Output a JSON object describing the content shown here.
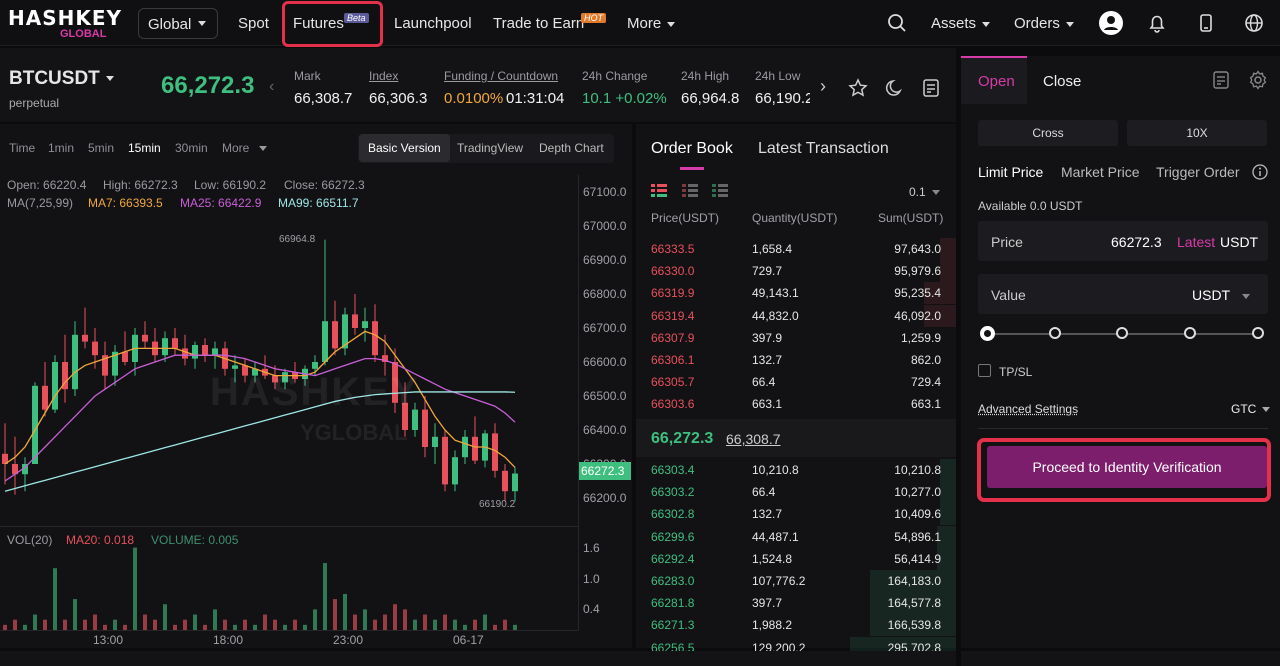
{
  "brand": {
    "logo": "HASHKEY",
    "logo_sub": "GLOBAL"
  },
  "nav": {
    "region": "Global",
    "links": [
      "Spot",
      "Futures",
      "Launchpool",
      "Trade to Earn",
      "More"
    ],
    "futures_badge": "Beta",
    "earn_badge": "HOT",
    "assets": "Assets",
    "orders": "Orders"
  },
  "ticker": {
    "pair": "BTCUSDT",
    "type": "perpetual",
    "last": "66,272.3",
    "stats": [
      {
        "label": "Mark",
        "value": "66,308.7"
      },
      {
        "label": "Index",
        "value": "66,306.3"
      },
      {
        "label": "Funding / Countdown",
        "value": "0.0100%",
        "value2": "01:31:04"
      },
      {
        "label": "24h Change",
        "value": "10.1 +0.02%"
      },
      {
        "label": "24h High",
        "value": "66,964.8"
      },
      {
        "label": "24h Low",
        "value": "66,190.2"
      }
    ]
  },
  "chart": {
    "timeframes": [
      "Time",
      "1min",
      "5min",
      "15min",
      "30min",
      "More"
    ],
    "versions": [
      "Basic Version",
      "TradingView",
      "Depth Chart"
    ],
    "ohlc": {
      "open": "Open: 66220.4",
      "high": "High: 66272.3",
      "low": "Low: 66190.2",
      "close": "Close: 66272.3"
    },
    "ma": {
      "label": "MA(7,25,99)",
      "ma7": "MA7: 66393.5",
      "ma25": "MA25: 66422.9",
      "ma99": "MA99: 66511.7"
    },
    "vol": {
      "label": "VOL(20)",
      "ma20": "MA20: 0.018",
      "volume": "VOLUME: 0.005"
    },
    "marker_high": "66964.8",
    "marker_low": "66190.2",
    "current_tag": "66272.3",
    "watermark": "HASHKEY",
    "watermark_sub": "YGLOBAL",
    "colors": {
      "up": "#3fbf7f",
      "down": "#e8505b",
      "ma7": "#f0a83a",
      "ma25": "#c95fd8",
      "ma99": "#9fe6e6"
    }
  },
  "chart_data": {
    "type": "line",
    "y_ticks": [
      "67100.0",
      "67000.0",
      "66900.0",
      "66800.0",
      "66700.0",
      "66600.0",
      "66500.0",
      "66400.0",
      "66300.0",
      "66200.0"
    ],
    "x_ticks": [
      "13:00",
      "18:00",
      "23:00",
      "06-17"
    ],
    "vol_ticks": [
      "1.6",
      "1.0",
      "0.4"
    ],
    "candles": [
      [
        66330,
        66420,
        66240,
        66300
      ],
      [
        66300,
        66380,
        66210,
        66270
      ],
      [
        66270,
        66320,
        66220,
        66300
      ],
      [
        66300,
        66540,
        66300,
        66530
      ],
      [
        66530,
        66600,
        66440,
        66460
      ],
      [
        66460,
        66620,
        66450,
        66600
      ],
      [
        66600,
        66680,
        66480,
        66520
      ],
      [
        66520,
        66720,
        66500,
        66680
      ],
      [
        66680,
        66760,
        66640,
        66660
      ],
      [
        66660,
        66700,
        66580,
        66620
      ],
      [
        66620,
        66660,
        66520,
        66560
      ],
      [
        66560,
        66650,
        66530,
        66630
      ],
      [
        66630,
        66690,
        66590,
        66600
      ],
      [
        66600,
        66700,
        66560,
        66680
      ],
      [
        66680,
        66720,
        66640,
        66660
      ],
      [
        66660,
        66700,
        66600,
        66620
      ],
      [
        66620,
        66690,
        66600,
        66670
      ],
      [
        66670,
        66700,
        66620,
        66640
      ],
      [
        66640,
        66680,
        66590,
        66610
      ],
      [
        66610,
        66660,
        66580,
        66650
      ],
      [
        66650,
        66670,
        66600,
        66620
      ],
      [
        66620,
        66660,
        66580,
        66640
      ],
      [
        66640,
        66660,
        66560,
        66580
      ],
      [
        66580,
        66620,
        66540,
        66590
      ],
      [
        66590,
        66610,
        66540,
        66560
      ],
      [
        66560,
        66600,
        66540,
        66580
      ],
      [
        66580,
        66620,
        66550,
        66560
      ],
      [
        66560,
        66590,
        66520,
        66540
      ],
      [
        66540,
        66580,
        66520,
        66570
      ],
      [
        66570,
        66600,
        66540,
        66550
      ],
      [
        66550,
        66590,
        66530,
        66580
      ],
      [
        66580,
        66620,
        66560,
        66600
      ],
      [
        66600,
        66960,
        66590,
        66720
      ],
      [
        66720,
        66780,
        66620,
        66640
      ],
      [
        66640,
        66760,
        66620,
        66740
      ],
      [
        66740,
        66800,
        66680,
        66700
      ],
      [
        66700,
        66760,
        66660,
        66720
      ],
      [
        66720,
        66770,
        66600,
        66620
      ],
      [
        66620,
        66680,
        66560,
        66600
      ],
      [
        66600,
        66640,
        66450,
        66480
      ],
      [
        66480,
        66540,
        66380,
        66400
      ],
      [
        66400,
        66480,
        66380,
        66460
      ],
      [
        66460,
        66500,
        66320,
        66350
      ],
      [
        66350,
        66420,
        66300,
        66380
      ],
      [
        66380,
        66400,
        66220,
        66240
      ],
      [
        66240,
        66340,
        66220,
        66320
      ],
      [
        66320,
        66400,
        66300,
        66380
      ],
      [
        66380,
        66440,
        66300,
        66310
      ],
      [
        66310,
        66400,
        66290,
        66390
      ],
      [
        66390,
        66420,
        66260,
        66280
      ],
      [
        66280,
        66300,
        66190,
        66220
      ],
      [
        66220,
        66290,
        66190,
        66272
      ]
    ],
    "ma7": [
      66300,
      66320,
      66350,
      66400,
      66450,
      66500,
      66540,
      66570,
      66590,
      66600,
      66610,
      66620,
      66630,
      66640,
      66640,
      66640,
      66640,
      66640,
      66630,
      66620,
      66620,
      66620,
      66610,
      66600,
      66590,
      66580,
      66570,
      66560,
      66560,
      66560,
      66560,
      66570,
      66600,
      66630,
      66650,
      66670,
      66690,
      66680,
      66660,
      66620,
      66580,
      66540,
      66490,
      66440,
      66400,
      66370,
      66360,
      66350,
      66350,
      66340,
      66320,
      66290
    ],
    "ma25": [
      66250,
      66270,
      66290,
      66320,
      66350,
      66380,
      66410,
      66440,
      66470,
      66500,
      66520,
      66540,
      66560,
      66580,
      66590,
      66600,
      66610,
      66620,
      66620,
      66620,
      66620,
      66620,
      66620,
      66615,
      66610,
      66600,
      66590,
      66580,
      66575,
      66570,
      66565,
      66560,
      66570,
      66580,
      66590,
      66600,
      66610,
      66610,
      66605,
      66595,
      66580,
      66565,
      66550,
      66535,
      66520,
      66510,
      66500,
      66490,
      66480,
      66470,
      66450,
      66423
    ],
    "ma99": [
      66220,
      66228,
      66236,
      66244,
      66252,
      66260,
      66268,
      66276,
      66284,
      66292,
      66300,
      66308,
      66316,
      66324,
      66332,
      66340,
      66348,
      66356,
      66364,
      66372,
      66380,
      66388,
      66396,
      66404,
      66412,
      66420,
      66428,
      66436,
      66444,
      66452,
      66460,
      66468,
      66476,
      66484,
      66490,
      66496,
      66500,
      66504,
      66506,
      66508,
      66510,
      66512,
      66512,
      66512,
      66512,
      66512,
      66512,
      66512,
      66512,
      66512,
      66512,
      66511
    ],
    "volume": [
      0.1,
      0.2,
      0.1,
      0.3,
      0.2,
      1.2,
      0.2,
      0.6,
      0.2,
      0.3,
      0.1,
      0.2,
      0.1,
      1.6,
      0.3,
      0.2,
      0.5,
      0.1,
      0.2,
      0.3,
      0.1,
      0.4,
      0.2,
      0.1,
      0.2,
      0.1,
      0.3,
      0.2,
      0.1,
      0.2,
      0.1,
      0.4,
      1.3,
      0.6,
      0.7,
      0.3,
      0.4,
      0.2,
      0.3,
      0.5,
      0.4,
      0.2,
      0.3,
      0.2,
      0.3,
      0.2,
      0.1,
      0.2,
      0.3,
      0.1,
      0.2,
      0.1
    ],
    "ylim": [
      66150,
      67150
    ]
  },
  "book": {
    "tabs": [
      "Order Book",
      "Latest Transaction"
    ],
    "precision": "0.1",
    "headers": [
      "Price(USDT)",
      "Quantity(USDT)",
      "Sum(USDT)"
    ],
    "asks": [
      [
        "66333.5",
        "1,658.4",
        "97,643.0",
        0.05
      ],
      [
        "66330.0",
        "729.7",
        "95,979.6",
        0.05
      ],
      [
        "66319.9",
        "49,143.1",
        "95,235.4",
        0.1
      ],
      [
        "66319.4",
        "44,832.0",
        "46,092.0",
        0.1
      ],
      [
        "66307.9",
        "397.9",
        "1,259.9",
        0
      ],
      [
        "66306.1",
        "132.7",
        "862.0",
        0
      ],
      [
        "66305.7",
        "66.4",
        "729.4",
        0
      ],
      [
        "66303.6",
        "663.1",
        "663.1",
        0
      ]
    ],
    "mid": "66,272.3",
    "mark": "66,308.7",
    "bids": [
      [
        "66303.4",
        "10,210.8",
        "10,210.8",
        0.05
      ],
      [
        "66303.2",
        "66.4",
        "10,277.0",
        0.05
      ],
      [
        "66302.8",
        "132.7",
        "10,409.6",
        0.05
      ],
      [
        "66299.6",
        "44,487.1",
        "54,896.1",
        0.06
      ],
      [
        "66292.4",
        "1,524.8",
        "56,414.9",
        0.06
      ],
      [
        "66283.0",
        "107,776.2",
        "164,183.0",
        0.27
      ],
      [
        "66281.8",
        "397.7",
        "164,577.8",
        0.27
      ],
      [
        "66271.3",
        "1,988.2",
        "166,539.8",
        0.27
      ],
      [
        "66256.5",
        "129,200.2",
        "295,702.8",
        0.33
      ]
    ]
  },
  "trade": {
    "tabs": [
      "Open",
      "Close"
    ],
    "margin": "Cross",
    "leverage": "10X",
    "order_types": [
      "Limit Price",
      "Market Price",
      "Trigger Order"
    ],
    "available": "Available 0.0 USDT",
    "price_label": "Price",
    "price_value": "66272.3",
    "latest": "Latest",
    "unit": "USDT",
    "value_label": "Value",
    "value_unit": "USDT",
    "tpsl": "TP/SL",
    "advanced": "Advanced Settings",
    "tif": "GTC",
    "proceed": "Proceed to Identity Verification"
  }
}
